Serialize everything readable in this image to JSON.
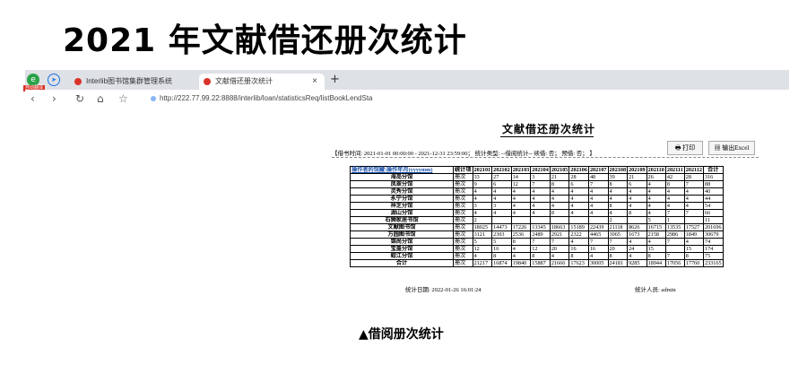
{
  "slide": {
    "title": "2021 年文献借还册次统计",
    "caption": "▲借阅册次统计"
  },
  "browser": {
    "ext_badge": "自动翻译",
    "tabs": [
      {
        "label": "Interlib图书馆集群管理系统"
      },
      {
        "label": "文献借还册次统计"
      }
    ],
    "close_glyph": "×",
    "new_tab_glyph": "+",
    "url": "http://222.77.99.22:8888/interlib/loan/statisticsReq/listBookLendSta"
  },
  "report": {
    "title": "文献借还册次统计",
    "params": "【借书时间: 2021-01-01 00:00:00 - 2021-12-31 23:59:00； 统计类型: --借阅统计-- 续借: 否； 预借: 否； 】",
    "print_label": "打印",
    "excel_label": "输出Excel",
    "header": {
      "main": "操作者的馆藏\\操作年月(yyyymm)",
      "type": "统计项",
      "months": [
        "202101",
        "202102",
        "202103",
        "202104",
        "202105",
        "202106",
        "202107",
        "202108",
        "202109",
        "202110",
        "202111",
        "202112"
      ],
      "total": "合计"
    },
    "rows": [
      {
        "name": "海岛分馆",
        "type": "册次",
        "values": [
          "33",
          "27",
          "14",
          "3",
          "21",
          "28",
          "48",
          "39",
          "21",
          "26",
          "42",
          "28"
        ],
        "total": "316"
      },
      {
        "name": "凤翠分馆",
        "type": "册次",
        "values": [
          "9",
          "6",
          "12",
          "7",
          "8",
          "6",
          "7",
          "8",
          "6",
          "4",
          "8",
          "7"
        ],
        "total": "88"
      },
      {
        "name": "灵秀分馆",
        "type": "册次",
        "values": [
          "4",
          "4",
          "4",
          "4",
          "4",
          "4",
          "4",
          "4",
          "4",
          "4",
          "4",
          "4"
        ],
        "total": "40"
      },
      {
        "name": "永宁分馆",
        "type": "册次",
        "values": [
          "4",
          "4",
          "4",
          "4",
          "4",
          "4",
          "4",
          "4",
          "4",
          "4",
          "4",
          "4"
        ],
        "total": "44"
      },
      {
        "name": "祥芝分馆",
        "type": "册次",
        "values": [
          "3",
          "3",
          "4",
          "4",
          "4",
          "4",
          "4",
          "8",
          "4",
          "4",
          "4",
          "4"
        ],
        "total": "54"
      },
      {
        "name": "湖山分馆",
        "type": "册次",
        "values": [
          "4",
          "4",
          "4",
          "4",
          "8",
          "4",
          "4",
          "4",
          "8",
          "4",
          "7",
          "7"
        ],
        "total": "66"
      },
      {
        "name": "石狮家居书馆",
        "type": "册次",
        "values": [
          "2",
          "",
          "",
          "",
          "",
          "",
          "",
          "2",
          "",
          "5",
          "1",
          ""
        ],
        "total": "11"
      },
      {
        "name": "文献图书馆",
        "type": "册次",
        "values": [
          "18025",
          "14473",
          "17226",
          "13345",
          "18663",
          "15189",
          "22439",
          "21118",
          "8626",
          "16715",
          "13535",
          "17527"
        ],
        "total": "201696"
      },
      {
        "name": "万园图书馆",
        "type": "册次",
        "values": [
          "3121",
          "2303",
          "2536",
          "2489",
          "2921",
          "2322",
          "4465",
          "3065",
          "1673",
          "2158",
          "2986",
          "1849"
        ],
        "total": "30679"
      },
      {
        "name": "锦尚分馆",
        "type": "册次",
        "values": [
          "5",
          "5",
          "8",
          "7",
          "7",
          "4",
          "7",
          "7",
          "4",
          "4",
          "7",
          "4"
        ],
        "total": "74"
      },
      {
        "name": "宝盖分馆",
        "type": "册次",
        "values": [
          "12",
          "16",
          "4",
          "12",
          "20",
          "16",
          "16",
          "20",
          "24",
          "15",
          "",
          "15"
        ],
        "total": "174"
      },
      {
        "name": "蚶江分馆",
        "type": "册次",
        "values": [
          "4",
          "8",
          "4",
          "8",
          "4",
          "8",
          "4",
          "8",
          "4",
          "8",
          "7",
          "8"
        ],
        "total": "75"
      },
      {
        "name": "合计",
        "type": "册次",
        "values": [
          "21217",
          "16874",
          "19840",
          "15887",
          "21666",
          "17623",
          "30005",
          "24181",
          "9285",
          "18944",
          "17056",
          "17760"
        ],
        "total": "233165"
      }
    ],
    "footer_date": "统计日期: 2022-01-26 16:01:24",
    "footer_user": "统计人员: admin"
  }
}
